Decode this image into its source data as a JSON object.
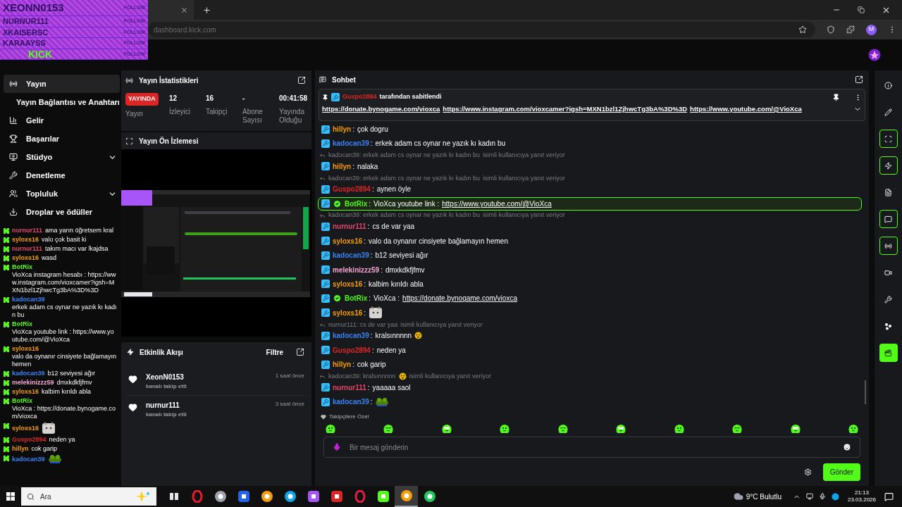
{
  "browser": {
    "address": "dashboard.kick.com",
    "profile_initial": "M"
  },
  "follow_overlay": {
    "logo": "KICK",
    "rows": [
      {
        "name": "XEONN0153",
        "action": "FOLLOW"
      },
      {
        "name": "NURNUR111",
        "action": "FOLLOW"
      },
      {
        "name": "XKAISERSC",
        "action": "FOLLOW"
      },
      {
        "name": "KARAAYSS",
        "action": "FOLLOW"
      },
      {
        "action": "FOLLOW"
      }
    ]
  },
  "sidebar": [
    {
      "label": "Yayın",
      "kind": "stream",
      "selected": true,
      "expandable": false,
      "children": [
        {
          "label": "Yayın Bağlantısı ve Anahtarı",
          "selected": false
        }
      ]
    },
    {
      "label": "Gelir",
      "kind": "chart",
      "selected": false,
      "expandable": false
    },
    {
      "label": "Başarılar",
      "kind": "trophy",
      "selected": false,
      "expandable": false
    },
    {
      "label": "Stüdyo",
      "kind": "studio",
      "selected": false,
      "expandable": true
    },
    {
      "label": "Denetleme",
      "kind": "wrench",
      "selected": false,
      "expandable": false
    },
    {
      "label": "Topluluk",
      "kind": "users",
      "selected": false,
      "expandable": true
    },
    {
      "label": "Droplar ve ödüller",
      "kind": "download",
      "selected": false,
      "expandable": false
    }
  ],
  "overlay_chat": [
    {
      "user": "nurnur111",
      "color": "#e0476b",
      "text": "ama yarın öğretsem kral"
    },
    {
      "user": "syloxs16",
      "color": "#f59e0b",
      "text": "valo çok basit ki"
    },
    {
      "user": "nurnur111",
      "color": "#e0476b",
      "text": "takım macı var lkajdsa"
    },
    {
      "user": "syloxs16",
      "color": "#f59e0b",
      "text": "wasd"
    },
    {
      "user": "BotRix",
      "color": "#53fc18",
      "text": "VioXca instagram hesabı : https://www.instagram.com/vioxcamer?igsh=MXN1bzl1ZjhwcTg3bA%3D%3D"
    },
    {
      "user": "kadocan39",
      "color": "#3b82f6",
      "text": "erkek adam cs oynar ne yazık kı kadın bu"
    },
    {
      "user": "BotRix",
      "color": "#53fc18",
      "text": "VioXca youtube link : https://www.youtube.com/@VioXca"
    },
    {
      "user": "syloxs16",
      "color": "#f59e0b",
      "text": "valo da oynanır cinsiyete bağlamayın hemen"
    },
    {
      "user": "kadocan39",
      "color": "#3b82f6",
      "text": "b12 seviyesi ağır"
    },
    {
      "user": "melekinizzz59",
      "color": "#f9a8d4",
      "text": "dmxkdkfjfmv"
    },
    {
      "user": "syloxs16",
      "color": "#f59e0b",
      "text": "kalbim kırıldı abla"
    },
    {
      "user": "BotRix",
      "color": "#53fc18",
      "text": "VioXca : https://donate.bynogame.com/vioxca"
    },
    {
      "user": "syloxs16",
      "color": "#f59e0b",
      "emote": {
        "kind": "cat"
      }
    },
    {
      "user": "Guspo2894",
      "color": "#dc2626",
      "text": "neden ya"
    },
    {
      "user": "hillyn",
      "color": "#f59e0b",
      "text": "cok garip"
    },
    {
      "user": "kadocan39",
      "color": "#3b82f6",
      "emote": {
        "kind": "frog"
      }
    }
  ],
  "stats": {
    "title": "Yayın İstatistikleri",
    "items": [
      {
        "kind": "badge",
        "value": "YAYINDA",
        "label": "Yayın"
      },
      {
        "kind": "number",
        "value": "12",
        "label": "İzleyici"
      },
      {
        "kind": "number",
        "value": "16",
        "label": "Takipçi"
      },
      {
        "kind": "number",
        "value": "-",
        "label": "Abone Sayısı"
      },
      {
        "kind": "number",
        "value": "00:41:58",
        "label": "Yayında Olduğu"
      }
    ]
  },
  "preview": {
    "title": "Yayın Ön İzlemesi"
  },
  "activity": {
    "title": "Etkinlik Akışı",
    "filter": "Filtre",
    "events": [
      {
        "user": "XeonN0153",
        "action": "kanalı takip etti",
        "time": "1 saat önce"
      },
      {
        "user": "nurnur111",
        "action": "kanalı takip etti",
        "time": "3 saat önce"
      }
    ]
  },
  "chat": {
    "title": "Sohbet",
    "pinned": {
      "by": {
        "name": "Guspo2894",
        "color": "#dc2626"
      },
      "suffix": "tarafından sabitlendi",
      "links": [
        "https://donate.bynogame.com/vioxca",
        "https://www.instagram.com/vioxcamer?igsh=MXN1bzl1ZjhwcTg3bA%3D%3D",
        "https://www.youtube.com/@VioXca"
      ]
    },
    "messages": [
      {
        "user": "hillyn",
        "color": "#f59e0b",
        "sep": ":",
        "text": "çok dogru",
        "verified": false,
        "highlighted": false
      },
      {
        "user": "kadocan39",
        "color": "#3b82f6",
        "sep": ":",
        "text": "erkek adam cs oynar ne yazık kı kadın bu",
        "verified": false,
        "highlighted": false
      },
      {
        "user": "hillyn",
        "color": "#f59e0b",
        "sep": ":",
        "text": "nalaka",
        "verified": false,
        "highlighted": false,
        "reply": {
          "quote": "kadocan39: erkek adam cs oynar ne yazık kı kadın bu",
          "suffix": "isimli kullanıcıya yanıt veriyor"
        }
      },
      {
        "user": "Guspo2894",
        "color": "#dc2626",
        "sep": ":",
        "text": "aynen öyle",
        "verified": false,
        "highlighted": false,
        "reply": {
          "quote": "kadocan39: erkek adam cs oynar ne yazık kı kadın bu",
          "suffix": "isimli kullanıcıya yanıt veriyor"
        }
      },
      {
        "user": "BotRix",
        "color": "#53fc18",
        "sep": ":",
        "text": "VioXca youtube link :",
        "link": "https://www.youtube.com/@VioXca",
        "verified": true,
        "highlighted": true
      },
      {
        "user": "nurnur111",
        "color": "#e0476b",
        "sep": ":",
        "text": "cs de var yaa",
        "verified": false,
        "highlighted": false,
        "reply": {
          "quote": "kadocan39: erkek adam cs oynar ne yazık kı kadın bu",
          "suffix": "isimli kullanıcıya yanıt veriyor"
        }
      },
      {
        "user": "syloxs16",
        "color": "#f59e0b",
        "sep": ":",
        "text": "valo da oynanır cinsiyete bağlamayın hemen",
        "verified": false,
        "highlighted": false
      },
      {
        "user": "kadocan39",
        "color": "#3b82f6",
        "sep": ":",
        "text": "b12 seviyesi ağır",
        "verified": false,
        "highlighted": false
      },
      {
        "user": "melekinizzz59",
        "color": "#f9a8d4",
        "sep": ":",
        "text": "dmxkdkfjfmv",
        "verified": false,
        "highlighted": false
      },
      {
        "user": "syloxs16",
        "color": "#f59e0b",
        "sep": ":",
        "text": "kalbim kırıldı abla",
        "verified": false,
        "highlighted": false
      },
      {
        "user": "BotRix",
        "color": "#53fc18",
        "sep": ":",
        "text": "VioXca :",
        "link": "https://donate.bynogame.com/vioxca",
        "verified": true,
        "highlighted": false
      },
      {
        "user": "syloxs16",
        "color": "#f59e0b",
        "sep": ":",
        "emote": {
          "kind": "cat"
        },
        "verified": false,
        "highlighted": false
      },
      {
        "user": "kadocan39",
        "color": "#3b82f6",
        "sep": ":",
        "text": "kralsınnnnn",
        "emote": {
          "kind": "face"
        },
        "verified": false,
        "highlighted": false,
        "reply": {
          "quote": "nurnur111: cs de var yaa",
          "suffix": "isimli kullanıcıya yanıt veriyor"
        }
      },
      {
        "user": "Guspo2894",
        "color": "#dc2626",
        "sep": ":",
        "text": "neden ya",
        "verified": false,
        "highlighted": false
      },
      {
        "user": "hillyn",
        "color": "#f59e0b",
        "sep": ":",
        "text": "cok garip",
        "verified": false,
        "highlighted": false
      },
      {
        "user": "nurnur111",
        "color": "#e0476b",
        "sep": ":",
        "text": "yaaaaa saol",
        "verified": false,
        "highlighted": false,
        "reply": {
          "quote": "kadocan39: kralsınnnnn",
          "emote": {
            "kind": "face"
          },
          "suffix": "isimli kullanıcıya yanıt veriyor"
        }
      },
      {
        "user": "kadocan39",
        "color": "#3b82f6",
        "sep": ":",
        "emote": {
          "kind": "frog"
        },
        "verified": false,
        "highlighted": false
      }
    ],
    "followers_only": "Takipçilere Özel",
    "placeholder": "Bir mesaj gönderin",
    "send": "Gönder"
  },
  "rail": [
    {
      "kind": "info",
      "active": false,
      "primary": false
    },
    {
      "kind": "pencil",
      "active": false,
      "primary": false
    },
    {
      "kind": "scan",
      "active": true,
      "primary": false
    },
    {
      "kind": "bolt",
      "active": true,
      "primary": false
    },
    {
      "kind": "document",
      "active": false,
      "primary": false
    },
    {
      "kind": "chat",
      "active": true,
      "primary": false
    },
    {
      "kind": "broadcast",
      "active": true,
      "primary": false
    },
    {
      "kind": "camera",
      "active": false,
      "primary": false
    },
    {
      "kind": "wrench",
      "active": false,
      "primary": false
    },
    {
      "kind": "nodes",
      "active": false,
      "primary": false
    },
    {
      "kind": "clapper",
      "active": false,
      "primary": true
    }
  ],
  "taskbar": {
    "search": "Ara",
    "weather": "9°C Bulutlu",
    "time": "21:13",
    "date": "23.03.2026",
    "apps": [
      {
        "kind": "taskview",
        "color": "#e5e7eb",
        "active": false
      },
      {
        "kind": "ring",
        "color": "#e11d2e",
        "active": false
      },
      {
        "kind": "disc",
        "color": "#9ca3af",
        "active": false
      },
      {
        "kind": "square",
        "color": "#2563eb",
        "active": false
      },
      {
        "kind": "disc",
        "color": "#f59e0b",
        "active": false
      },
      {
        "kind": "disc",
        "color": "#0ea5e9",
        "active": false
      },
      {
        "kind": "square",
        "color": "#a855f7",
        "active": false
      },
      {
        "kind": "square",
        "color": "#dc2626",
        "active": false
      },
      {
        "kind": "ring",
        "color": "#e11d48",
        "active": false
      },
      {
        "kind": "square",
        "color": "#53fc18",
        "active": false
      },
      {
        "kind": "disc",
        "color": "#f59e0b",
        "active": true
      },
      {
        "kind": "disc",
        "color": "#22c55e",
        "active": false
      }
    ]
  }
}
